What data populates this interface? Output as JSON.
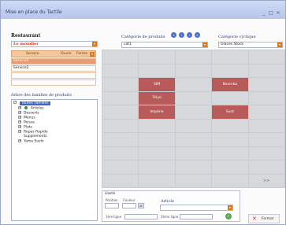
{
  "window": {
    "title": "Mise en place du Tactile"
  },
  "restaurant": {
    "label": "Restaurant",
    "value": "Le mondier"
  },
  "services": {
    "headers": [
      "Service",
      "Ouvre",
      "Ferme"
    ],
    "rows": [
      "Service1",
      "Service2"
    ]
  },
  "tree": {
    "title": "Arbre des familles de produits",
    "root": "Toutes Familles",
    "items": [
      "Articles",
      "Desserts",
      "Menus",
      "Poisse",
      "Plats",
      "Repas Rapide",
      "Supplements",
      "Yama Sushi"
    ]
  },
  "category": {
    "label": "Catégorie de produits",
    "value": "cat1"
  },
  "cyclic": {
    "label": "Catégorie cyclique",
    "value": "Glaces Stock"
  },
  "grid": {
    "cells": {
      "11": "SIM",
      "13": "Boomba",
      "16": "Telyo",
      "21": "Impérie",
      "23": "Sunt",
      "49": ">>"
    }
  },
  "bottom": {
    "group_label": "Libellé",
    "position_label": "Position",
    "couleur_label": "Couleur",
    "article_label": "Article",
    "line1_label": "1ère ligne",
    "line2_label": "2ème ligne"
  },
  "close_label": "Fermer",
  "colors": {
    "accent_orange": "#e07a1a",
    "cell_red": "#b85a5a",
    "selection_blue": "#3b66c4"
  }
}
